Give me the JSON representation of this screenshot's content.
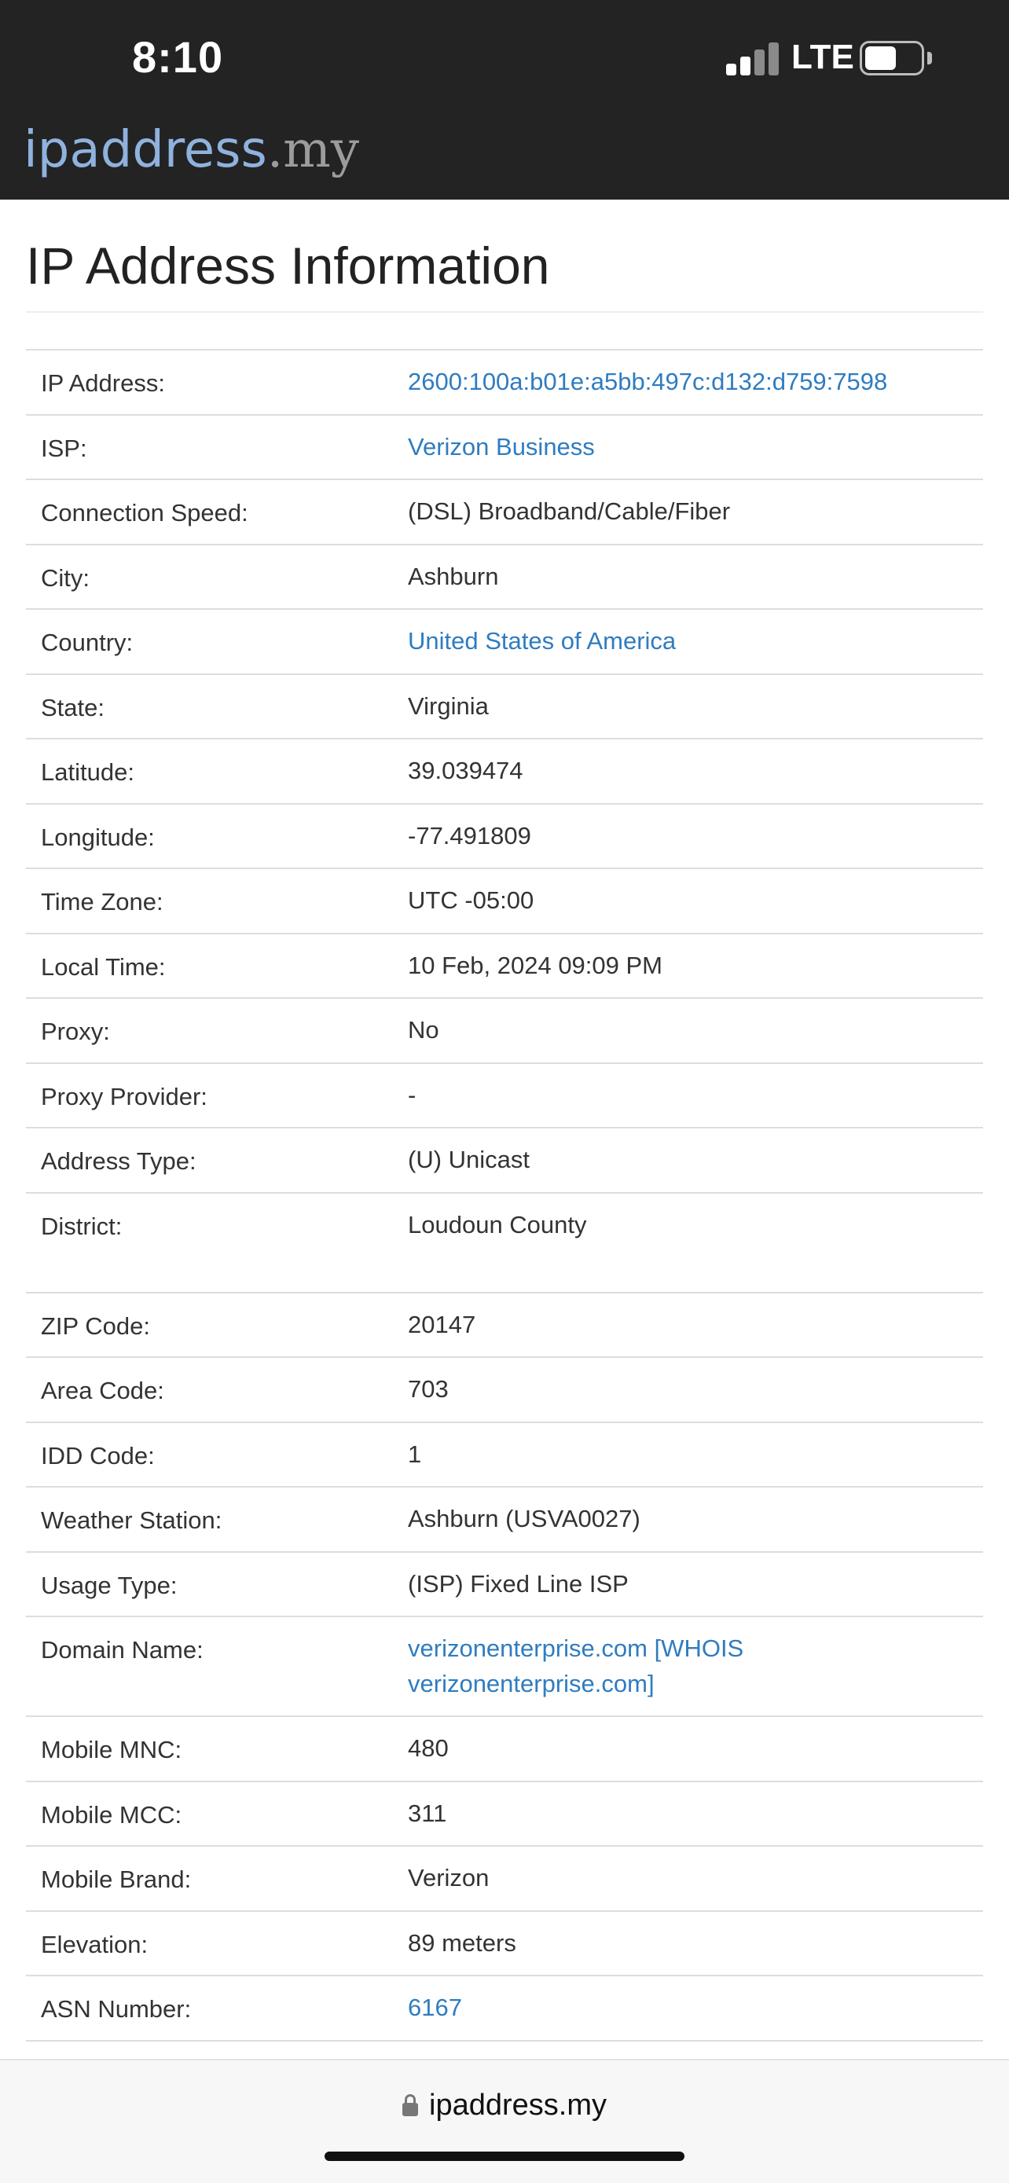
{
  "status_bar": {
    "time": "8:10",
    "network": "LTE",
    "signal_bars_active": 2,
    "signal_bars_total": 4,
    "battery_level": 0.55
  },
  "site": {
    "logo_main": "ipaddress",
    "logo_tld": ".my"
  },
  "page": {
    "title": "IP Address Information"
  },
  "info_rows": [
    {
      "label": "IP Address:",
      "value": "2600:100a:b01e:a5bb:497c:d132:d759:7598",
      "link": true
    },
    {
      "label": "ISP:",
      "value": "Verizon Business",
      "link": true
    },
    {
      "label": "Connection Speed:",
      "value": "(DSL) Broadband/Cable/Fiber",
      "link": false
    },
    {
      "label": "City:",
      "value": "Ashburn",
      "link": false
    },
    {
      "label": "Country:",
      "value": "United States of America",
      "link": true
    },
    {
      "label": "State:",
      "value": "Virginia",
      "link": false
    },
    {
      "label": "Latitude:",
      "value": "39.039474",
      "link": false
    },
    {
      "label": "Longitude:",
      "value": "-77.491809",
      "link": false
    },
    {
      "label": "Time Zone:",
      "value": "UTC -05:00",
      "link": false
    },
    {
      "label": "Local Time:",
      "value": "10 Feb, 2024 09:09 PM",
      "link": false
    },
    {
      "label": "Proxy:",
      "value": "No",
      "link": false
    },
    {
      "label": "Proxy Provider:",
      "value": "-",
      "link": false
    },
    {
      "label": "Address Type:",
      "value": "(U) Unicast",
      "link": false
    },
    {
      "label": "District:",
      "value": "Loudoun County",
      "link": false,
      "tall": true
    },
    {
      "label": "ZIP Code:",
      "value": "20147",
      "link": false
    },
    {
      "label": "Area Code:",
      "value": "703",
      "link": false
    },
    {
      "label": "IDD Code:",
      "value": "1",
      "link": false
    },
    {
      "label": "Weather Station:",
      "value": "Ashburn (USVA0027)",
      "link": false
    },
    {
      "label": "Usage Type:",
      "value": "(ISP) Fixed Line ISP",
      "link": false
    },
    {
      "label": "Domain Name:",
      "value": "verizonenterprise.com [WHOIS verizonenterprise.com]",
      "link": true,
      "tall": true
    },
    {
      "label": "Mobile MNC:",
      "value": "480",
      "link": false
    },
    {
      "label": "Mobile MCC:",
      "value": "311",
      "link": false
    },
    {
      "label": "Mobile Brand:",
      "value": "Verizon",
      "link": false
    },
    {
      "label": "Elevation:",
      "value": "89 meters",
      "link": false
    },
    {
      "label": "ASN Number:",
      "value": "6167",
      "link": true
    }
  ],
  "browser": {
    "url": "ipaddress.my"
  },
  "colors": {
    "header_bg": "#232323",
    "link": "#2f7cc0",
    "logo_main": "#8fb2de",
    "logo_tld": "#9c9c9c",
    "signal_active": "#ffffff",
    "signal_inactive": "#8a8a8a"
  }
}
